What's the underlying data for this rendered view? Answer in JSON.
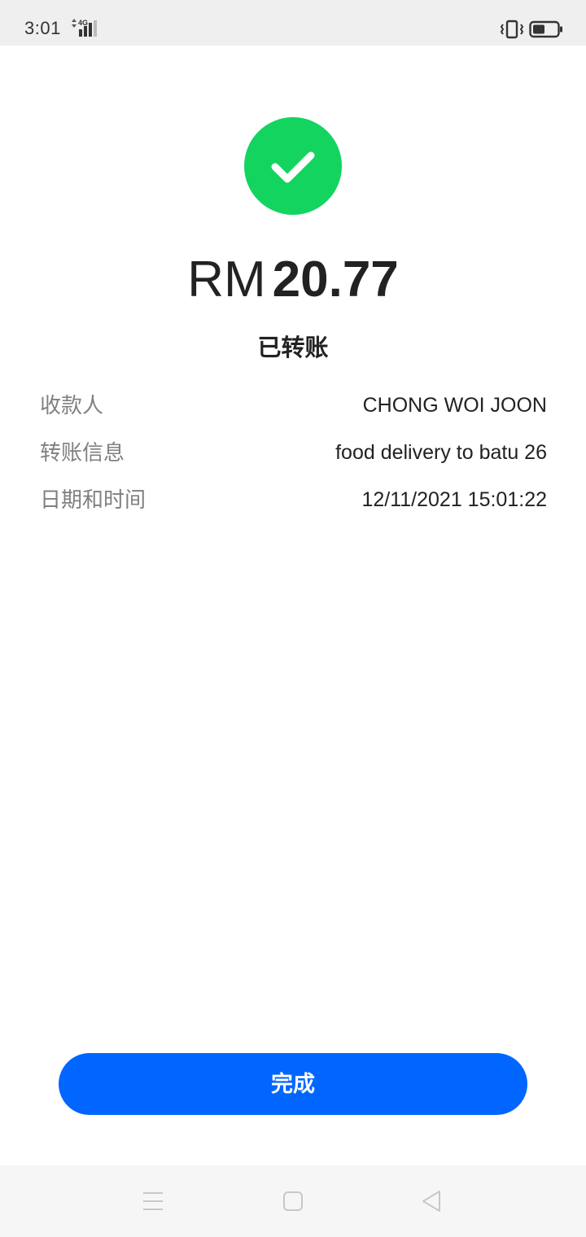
{
  "status_bar": {
    "time": "3:01",
    "network": "4G",
    "icons": [
      "signal-icon",
      "vibrate-icon",
      "battery-icon"
    ]
  },
  "success": {
    "icon": "checkmark-icon",
    "color": "#13d45f"
  },
  "amount": {
    "currency": "RM",
    "value": "20.77"
  },
  "status_label": "已转账",
  "details": [
    {
      "label": "收款人",
      "value": "CHONG WOI JOON"
    },
    {
      "label": "转账信息",
      "value": "food delivery to batu 26"
    },
    {
      "label": "日期和时间",
      "value": "12/11/2021 15:01:22"
    }
  ],
  "done_button": {
    "label": "完成",
    "color": "#0066ff"
  },
  "nav_bar": {
    "icons": [
      "menu-icon",
      "home-icon",
      "back-icon"
    ]
  }
}
